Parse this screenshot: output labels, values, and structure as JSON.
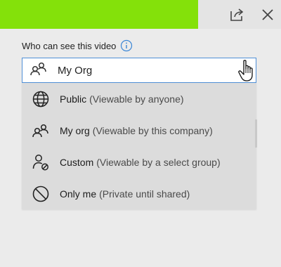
{
  "toolbar": {
    "accent_color": "#84e10a",
    "share_icon": "share-icon",
    "close_icon": "close-icon"
  },
  "visibility": {
    "label": "Who can see this video",
    "info_icon": "info-icon",
    "selected": {
      "icon": "people-icon",
      "label": "My Org"
    },
    "options": [
      {
        "icon": "globe-icon",
        "title": "Public",
        "desc": "(Viewable by anyone)"
      },
      {
        "icon": "people-icon",
        "title": "My org",
        "desc": "(Viewable by this company)"
      },
      {
        "icon": "custom-group-icon",
        "title": "Custom",
        "desc": "(Viewable by a select group)"
      },
      {
        "icon": "block-icon",
        "title": "Only me",
        "desc": "(Private until shared)"
      }
    ]
  }
}
